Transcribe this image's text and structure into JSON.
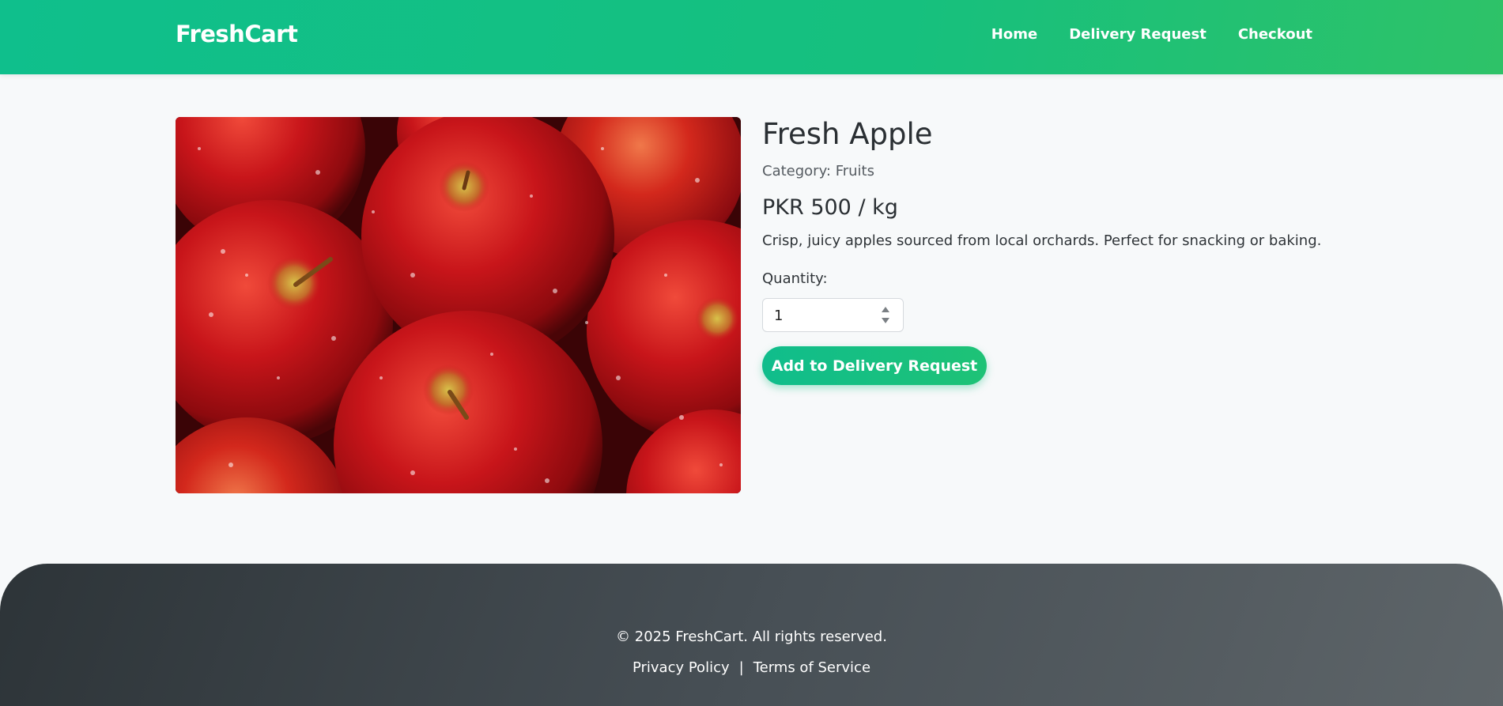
{
  "header": {
    "brand": "FreshCart",
    "nav": [
      "Home",
      "Delivery Request",
      "Checkout"
    ]
  },
  "product": {
    "title": "Fresh Apple",
    "category": "Category: Fruits",
    "price": "PKR 500 / kg",
    "description": "Crisp, juicy apples sourced from local orchards. Perfect for snacking or baking.",
    "quantity_label": "Quantity:",
    "quantity_value": "1",
    "add_button_label": "Add to Delivery Request",
    "image_alt": "Fresh Apple"
  },
  "footer": {
    "copyright": "© 2025 FreshCart. All rights reserved.",
    "links": [
      "Privacy Policy",
      "Terms of Service"
    ],
    "separator": "|"
  },
  "colors": {
    "brand_green": "#10bd8c",
    "footer_dark": "#2d3438"
  }
}
